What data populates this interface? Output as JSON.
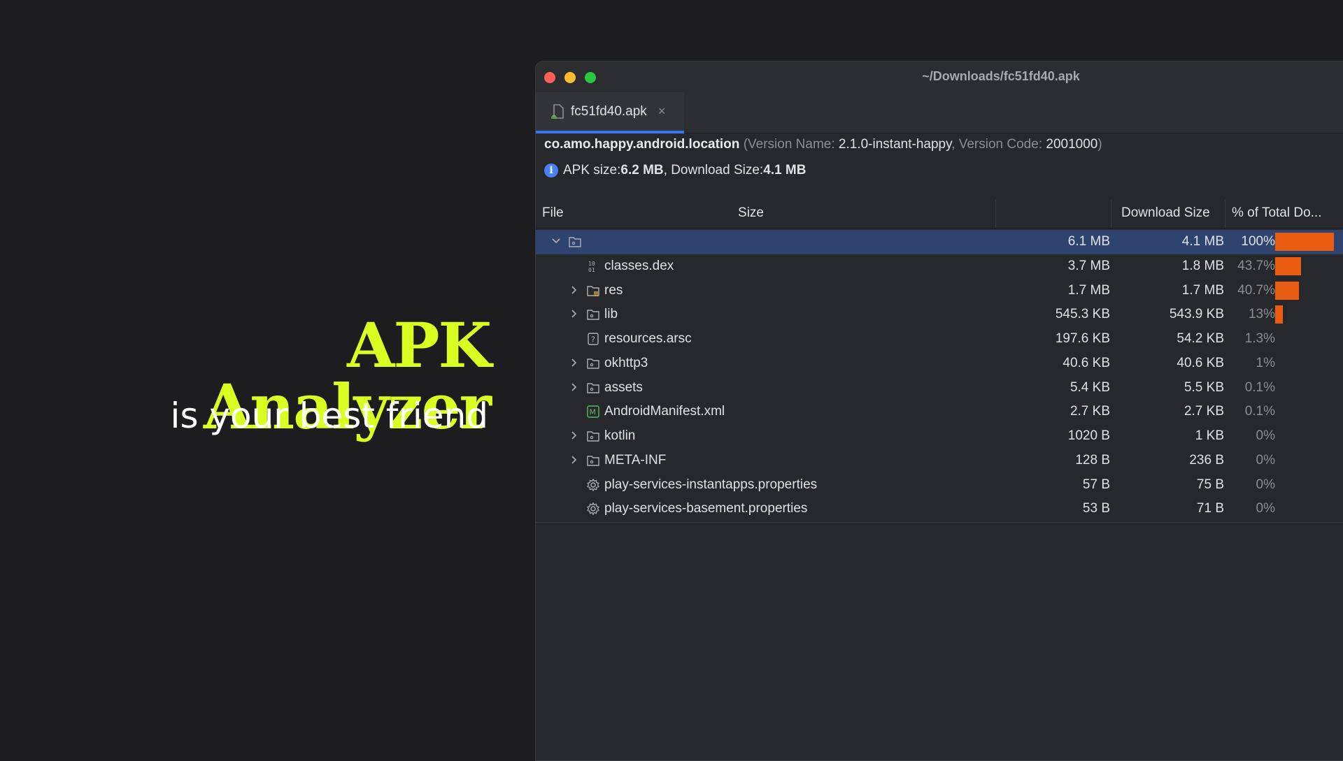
{
  "hero": {
    "title": "APK Analyzer",
    "subtitle": "is your best friend"
  },
  "window": {
    "title": "~/Downloads/fc51fd40.apk",
    "tab_label": "fc51fd40.apk",
    "tab_close": "×"
  },
  "info": {
    "package": "co.amo.happy.android.location",
    "version_name_label": "Version Name: ",
    "version_name": "2.1.0-instant-happy",
    "version_code_label": "Version Code: ",
    "version_code": "2001000",
    "apk_size_label": "APK size: ",
    "apk_size": "6.2 MB",
    "download_size_label": "Download Size: ",
    "download_size": "4.1 MB"
  },
  "columns": {
    "file": "File",
    "size": "Size",
    "download_size": "Download Size",
    "percent": "% of Total Do..."
  },
  "colors": {
    "accent": "#d9ff22",
    "bar": "#e85d10",
    "selection": "#2e436e",
    "tab_underline": "#3574f0"
  },
  "rows": [
    {
      "name": "",
      "icon": "folder-icon",
      "expand": "expanded",
      "size": "6.1 MB",
      "download": "4.1 MB",
      "percent": "100%",
      "fraction": 1.0,
      "selected": true
    },
    {
      "name": "classes.dex",
      "icon": "dex-icon",
      "expand": "none",
      "size": "3.7 MB",
      "download": "1.8 MB",
      "percent": "43.7%",
      "fraction": 0.437
    },
    {
      "name": "res",
      "icon": "res-folder-icon",
      "expand": "collapsed",
      "size": "1.7 MB",
      "download": "1.7 MB",
      "percent": "40.7%",
      "fraction": 0.407
    },
    {
      "name": "lib",
      "icon": "folder-icon",
      "expand": "collapsed",
      "size": "545.3 KB",
      "download": "543.9 KB",
      "percent": "13%",
      "fraction": 0.13
    },
    {
      "name": "resources.arsc",
      "icon": "unknown-file-icon",
      "expand": "none",
      "size": "197.6 KB",
      "download": "54.2 KB",
      "percent": "1.3%",
      "fraction": 0.013
    },
    {
      "name": "okhttp3",
      "icon": "folder-icon",
      "expand": "collapsed",
      "size": "40.6 KB",
      "download": "40.6 KB",
      "percent": "1%",
      "fraction": 0.01
    },
    {
      "name": "assets",
      "icon": "folder-icon",
      "expand": "collapsed",
      "size": "5.4 KB",
      "download": "5.5 KB",
      "percent": "0.1%",
      "fraction": 0.001
    },
    {
      "name": "AndroidManifest.xml",
      "icon": "manifest-icon",
      "expand": "none",
      "size": "2.7 KB",
      "download": "2.7 KB",
      "percent": "0.1%",
      "fraction": 0.001
    },
    {
      "name": "kotlin",
      "icon": "folder-icon",
      "expand": "collapsed",
      "size": "1020 B",
      "download": "1 KB",
      "percent": "0%",
      "fraction": 0
    },
    {
      "name": "META-INF",
      "icon": "folder-icon",
      "expand": "collapsed",
      "size": "128 B",
      "download": "236 B",
      "percent": "0%",
      "fraction": 0
    },
    {
      "name": "play-services-instantapps.properties",
      "icon": "gear-icon",
      "expand": "none",
      "size": "57 B",
      "download": "75 B",
      "percent": "0%",
      "fraction": 0
    },
    {
      "name": "play-services-basement.properties",
      "icon": "gear-icon",
      "expand": "none",
      "size": "53 B",
      "download": "71 B",
      "percent": "0%",
      "fraction": 0
    }
  ]
}
